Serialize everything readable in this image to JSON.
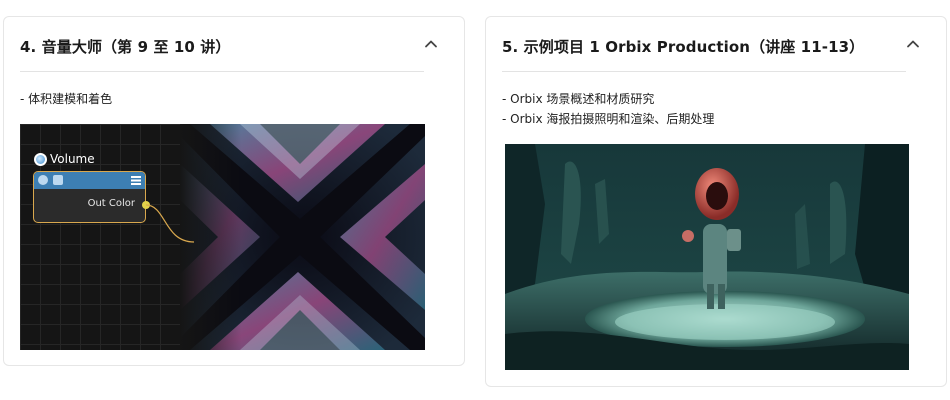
{
  "cards": [
    {
      "title": "4. 音量大师（第 9 至 10 讲）",
      "bullets": [
        "- 体积建模和着色"
      ],
      "node": {
        "title": "Volume",
        "output_label": "Out Color"
      }
    },
    {
      "title": "5. 示例项目 1 Orbix Production（讲座 11-13）",
      "bullets": [
        "- Orbix 场景概述和材质研究",
        "- Orbix 海报拍摄照明和渲染、后期处理"
      ]
    }
  ],
  "icons": {
    "collapse": "chevron-up-icon"
  },
  "colors": {
    "node_border": "#d9a84e",
    "node_header": "#3d7fb3",
    "port": "#e2d24a"
  }
}
